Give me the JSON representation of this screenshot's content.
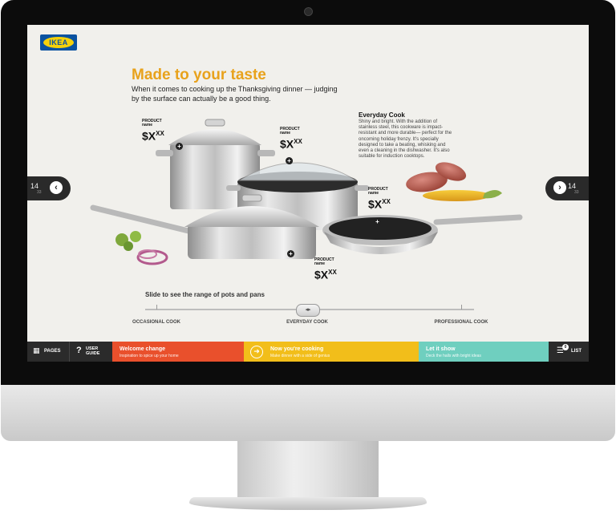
{
  "brand": {
    "logo_text": "IKEA",
    "accent": "#e8a21c"
  },
  "page": {
    "title": "Made to your taste",
    "subtitle": "When it comes to cooking up the Thanksgiving dinner — judging by the surface can actually be a good thing.",
    "description": {
      "heading": "Everyday Cook",
      "body": "Shiny and bright. With the addition of stainless steel, this cookware is impact-resistant and more durable— perfect for the oncoming holiday frenzy. It's specially designed to take a beating, whisking and even a cleaning in the dishwasher. It's also suitable for induction cooktops."
    }
  },
  "prices": [
    {
      "label": "PRODUCT name",
      "symbol": "$",
      "value": "X",
      "cents": "XX"
    },
    {
      "label": "PRODUCT name",
      "symbol": "$",
      "value": "X",
      "cents": "XX"
    },
    {
      "label": "PRODUCT name",
      "symbol": "$",
      "value": "X",
      "cents": "XX"
    },
    {
      "label": "PRODUCT name",
      "symbol": "$",
      "value": "X",
      "cents": "XX"
    }
  ],
  "nav": {
    "prev": {
      "page": "14",
      "total": "33",
      "icon": "chevron-left-icon"
    },
    "next": {
      "page": "14",
      "total": "33",
      "icon": "chevron-right-icon"
    }
  },
  "slider": {
    "label": "Slide to see the range of pots and pans",
    "stops": [
      "OCCASIONAL COOK",
      "EVERYDAY COOK",
      "PROFESSIONAL COOK"
    ],
    "selected": "EVERYDAY COOK",
    "thumb_glyph": "◂▸"
  },
  "bottom_bar": {
    "pages_label": "PAGES",
    "guide_label": "USER GUIDE",
    "sections": [
      {
        "title": "Welcome change",
        "subtitle": "Inspiration to spice up your home",
        "color": "#e9502c"
      },
      {
        "title": "Now you're cooking",
        "subtitle": "Make dinner with a side of genius",
        "color": "#f2be1a"
      },
      {
        "title": "Let it show",
        "subtitle": "Deck the halls with bright ideas",
        "color": "#6fcfbf"
      }
    ],
    "list_label": "LIST",
    "list_count": "0"
  }
}
